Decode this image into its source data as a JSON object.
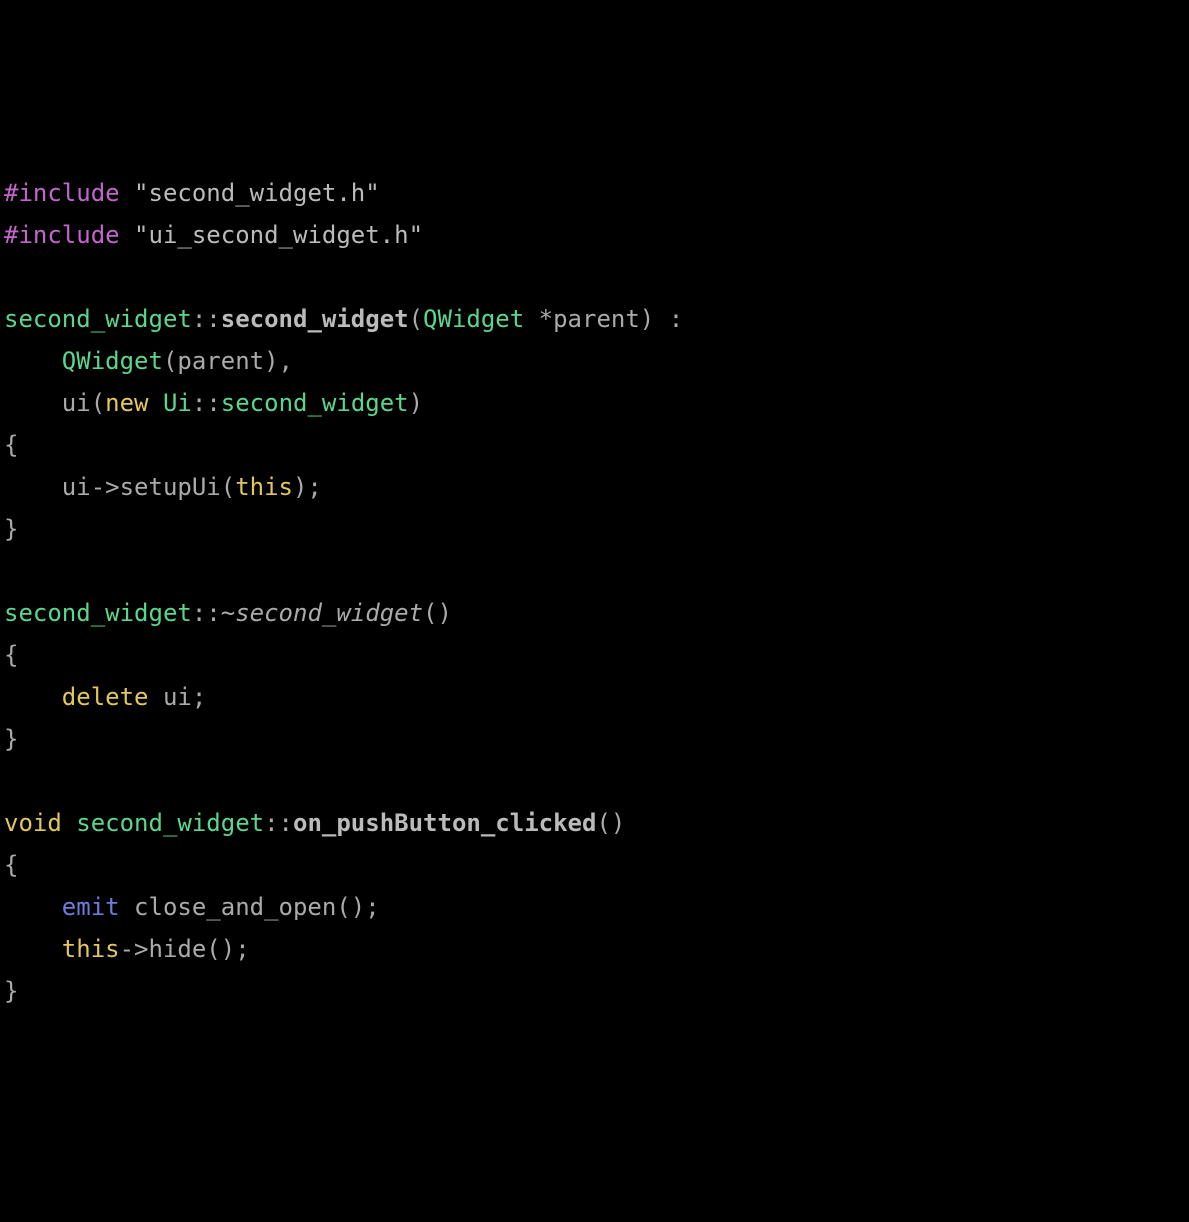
{
  "code": {
    "line1_include": "#include",
    "line1_str": "\"second_widget.h\"",
    "line2_include": "#include",
    "line2_str": "\"ui_second_widget.h\"",
    "ctor_cls1": "second_widget",
    "ctor_dc": "::",
    "ctor_name": "second_widget",
    "ctor_lpar": "(",
    "ctor_type": "QWidget",
    "ctor_after_type": " *parent) :",
    "ctor_init1_cls": "QWidget",
    "ctor_init1_rest": "(parent),",
    "ctor_init2_pre": "ui(",
    "ctor_new": "new",
    "ctor_init2_ns": " Ui",
    "ctor_init2_dc": "::",
    "ctor_init2_cls": "second_widget",
    "ctor_init2_rest": ")",
    "ctor_lbrace": "{",
    "ctor_body_pre": "    ui->setupUi(",
    "ctor_body_this": "this",
    "ctor_body_rest": ");",
    "ctor_rbrace": "}",
    "dtor_cls": "second_widget",
    "dtor_dc": "::",
    "dtor_tilde": "~",
    "dtor_name": "second_widget",
    "dtor_rest": "()",
    "dtor_lbrace": "{",
    "dtor_delete": "delete",
    "dtor_ui": " ui;",
    "dtor_rbrace": "}",
    "m_void": "void",
    "m_sp": " ",
    "m_cls": "second_widget",
    "m_dc": "::",
    "m_name": "on_pushButton_clicked",
    "m_rest": "()",
    "m_lbrace": "{",
    "m_emit": "emit",
    "m_emit_rest": " close_and_open();",
    "m_this": "this",
    "m_this_rest": "->hide();",
    "m_rbrace": "}"
  }
}
